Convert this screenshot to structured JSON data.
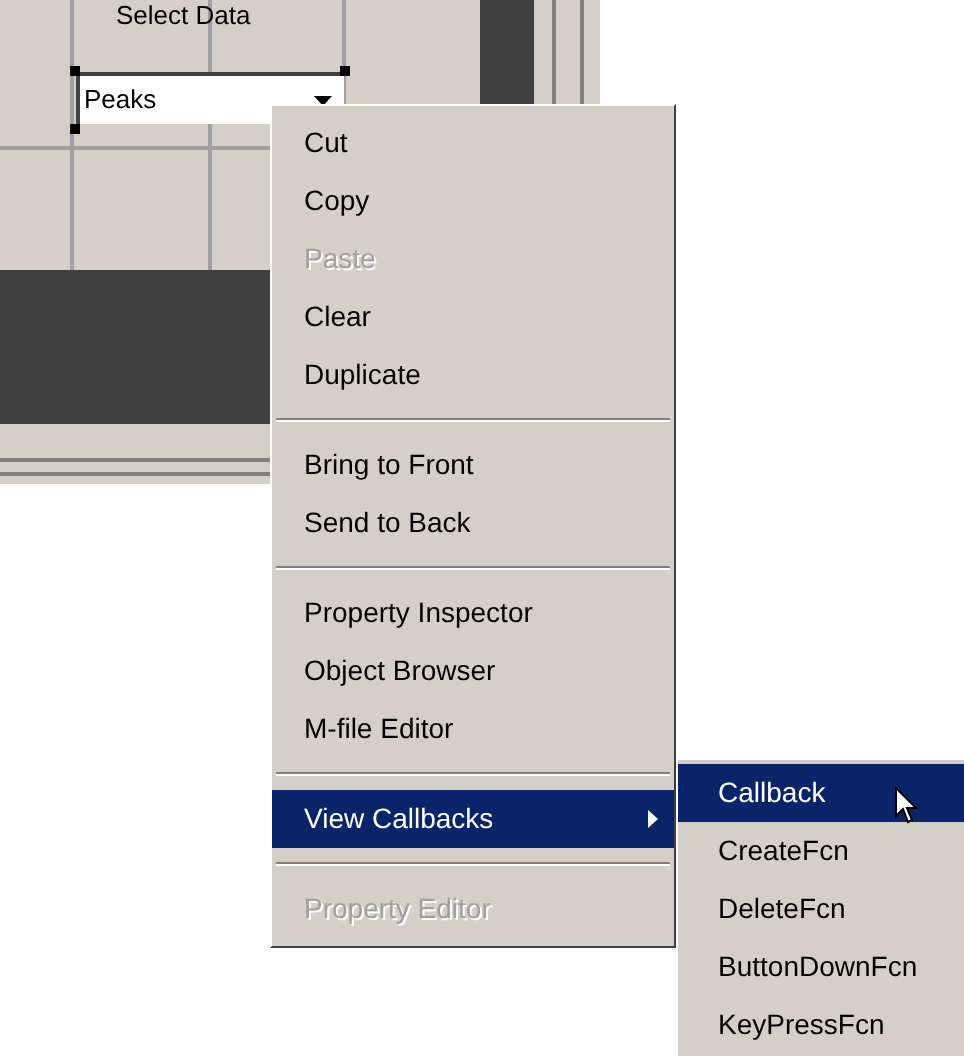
{
  "layout_canvas": {
    "label": "Select Data",
    "popup_menu": {
      "value": "Peaks",
      "selected": true
    }
  },
  "context_menu": {
    "items": [
      {
        "kind": "item",
        "label": "Cut",
        "disabled": false,
        "selected": false
      },
      {
        "kind": "item",
        "label": "Copy",
        "disabled": false,
        "selected": false
      },
      {
        "kind": "item",
        "label": "Paste",
        "disabled": true,
        "selected": false
      },
      {
        "kind": "item",
        "label": "Clear",
        "disabled": false,
        "selected": false
      },
      {
        "kind": "item",
        "label": "Duplicate",
        "disabled": false,
        "selected": false
      },
      {
        "kind": "separator"
      },
      {
        "kind": "item",
        "label": "Bring to Front",
        "disabled": false,
        "selected": false
      },
      {
        "kind": "item",
        "label": "Send to Back",
        "disabled": false,
        "selected": false
      },
      {
        "kind": "separator"
      },
      {
        "kind": "item",
        "label": "Property Inspector",
        "disabled": false,
        "selected": false
      },
      {
        "kind": "item",
        "label": "Object Browser",
        "disabled": false,
        "selected": false
      },
      {
        "kind": "item",
        "label": "M-file Editor",
        "disabled": false,
        "selected": false
      },
      {
        "kind": "separator"
      },
      {
        "kind": "submenu",
        "label": "View Callbacks",
        "disabled": false,
        "selected": true
      },
      {
        "kind": "separator"
      },
      {
        "kind": "item",
        "label": "Property Editor",
        "disabled": true,
        "selected": false
      }
    ]
  },
  "submenu": {
    "items": [
      {
        "label": "Callback",
        "selected": true
      },
      {
        "label": "CreateFcn",
        "selected": false
      },
      {
        "label": "DeleteFcn",
        "selected": false
      },
      {
        "label": "ButtonDownFcn",
        "selected": false
      },
      {
        "label": "KeyPressFcn",
        "selected": false
      }
    ]
  }
}
